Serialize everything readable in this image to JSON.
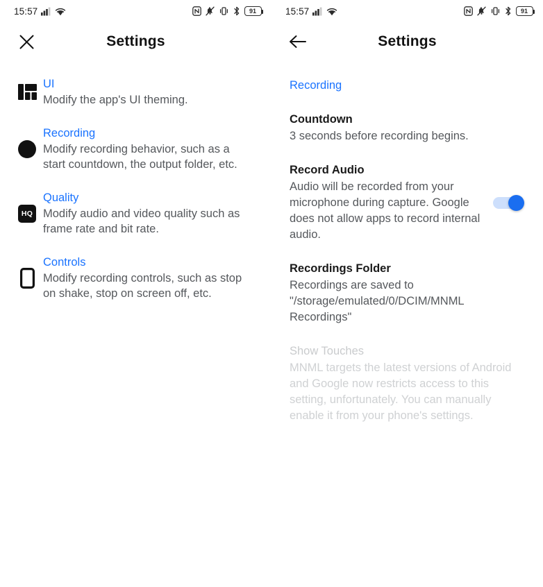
{
  "status_bar": {
    "time": "15:57",
    "battery_level": "91",
    "icons_left": [
      "signal-bars-icon",
      "wifi-icon"
    ],
    "icons_right": [
      "nfc-icon",
      "ringer-silent-icon",
      "vibrate-icon",
      "bluetooth-icon",
      "battery-icon"
    ]
  },
  "colors": {
    "accent_blue": "#1a73ff",
    "toggle_thumb": "#1a6ef0",
    "toggle_track": "#cddffc",
    "title_text": "#121212",
    "summary_text": "#55585c",
    "disabled_text": "#cfd1d3",
    "background": "#ffffff"
  },
  "left_screen": {
    "app_bar": {
      "nav_icon": "close-icon",
      "title": "Settings"
    },
    "items": [
      {
        "icon": "dashboard-layout-icon",
        "title": "UI",
        "description": "Modify the app's UI theming."
      },
      {
        "icon": "record-circle-icon",
        "title": "Recording",
        "description": "Modify recording behavior, such as a start countdown, the output folder, etc."
      },
      {
        "icon": "hq-badge-icon",
        "icon_label": "HQ",
        "title": "Quality",
        "description": "Modify audio and video quality such as frame rate and bit rate."
      },
      {
        "icon": "phone-outline-icon",
        "title": "Controls",
        "description": "Modify recording controls, such as stop on shake, stop on screen off, etc."
      }
    ]
  },
  "right_screen": {
    "app_bar": {
      "nav_icon": "back-arrow-icon",
      "title": "Settings"
    },
    "category": "Recording",
    "preferences": [
      {
        "title": "Countdown",
        "summary": "3 seconds before recording begins.",
        "control": "none",
        "enabled": true
      },
      {
        "title": "Record Audio",
        "summary": "Audio will be recorded from your microphone during capture. Google does not allow apps to record internal audio.",
        "control": "switch",
        "switch_state": "on",
        "enabled": true
      },
      {
        "title": "Recordings Folder",
        "summary": "Recordings are saved to \"/storage/emulated/0/DCIM/MNML Recordings\"",
        "control": "none",
        "enabled": true
      },
      {
        "title": "Show Touches",
        "summary": "MNML targets the latest versions of Android and Google now restricts access to this setting, unfortunately. You can manually enable it from your phone's settings.",
        "control": "none",
        "enabled": false
      }
    ]
  }
}
